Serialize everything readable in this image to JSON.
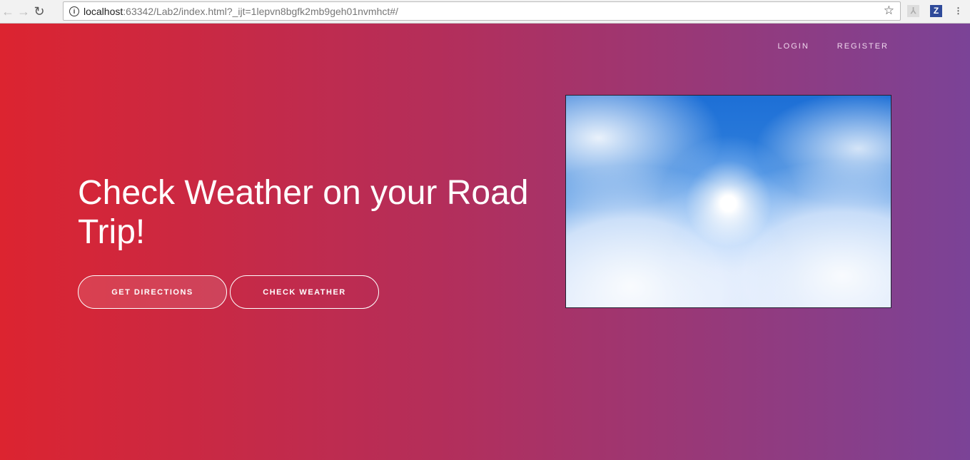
{
  "browser": {
    "url_host": "localhost",
    "url_path": ":63342/Lab2/index.html?_ijt=1lepvn8bgfk2mb9geh01nvmhct#/",
    "ext_z": "Z"
  },
  "nav": {
    "login": "LOGIN",
    "register": "REGISTER"
  },
  "hero": {
    "title": "Check Weather on your Road Trip!",
    "get_directions": "GET DIRECTIONS",
    "check_weather": "CHECK WEATHER"
  },
  "colors": {
    "gradient_start": "#dc2430",
    "gradient_end": "#7b4397"
  }
}
